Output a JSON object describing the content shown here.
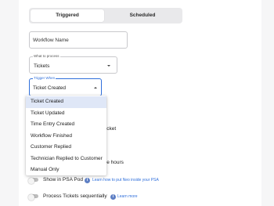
{
  "toggle": {
    "triggered_label": "Triggered",
    "scheduled_label": "Scheduled"
  },
  "workflow_name": {
    "placeholder": "Workflow Name"
  },
  "what_to_process": {
    "label": "What to process",
    "value": "Tickets"
  },
  "trigger_when": {
    "label": "Trigger When",
    "value": "Ticket Created"
  },
  "dropdown": {
    "options": [
      "Ticket Created",
      "Ticket Updated",
      "Time Entry Created",
      "Workflow Finished",
      "Customer Replied",
      "Technician Replied to Customer",
      "Manual Only"
    ],
    "selected": "Ticket Created"
  },
  "obscured": {
    "ticket_fragment": "ticket",
    "hours_fragment": "se hours"
  },
  "switches": {
    "psa_pod": {
      "label": "Show in PSA Pod",
      "link": "Learn how to put Neo inside your PSA"
    },
    "sequential": {
      "label": "Process Tickets sequentially",
      "link": "Learn more"
    }
  },
  "colors": {
    "accent": "#2f6fdb",
    "selected_bg": "#dfe7f7"
  }
}
